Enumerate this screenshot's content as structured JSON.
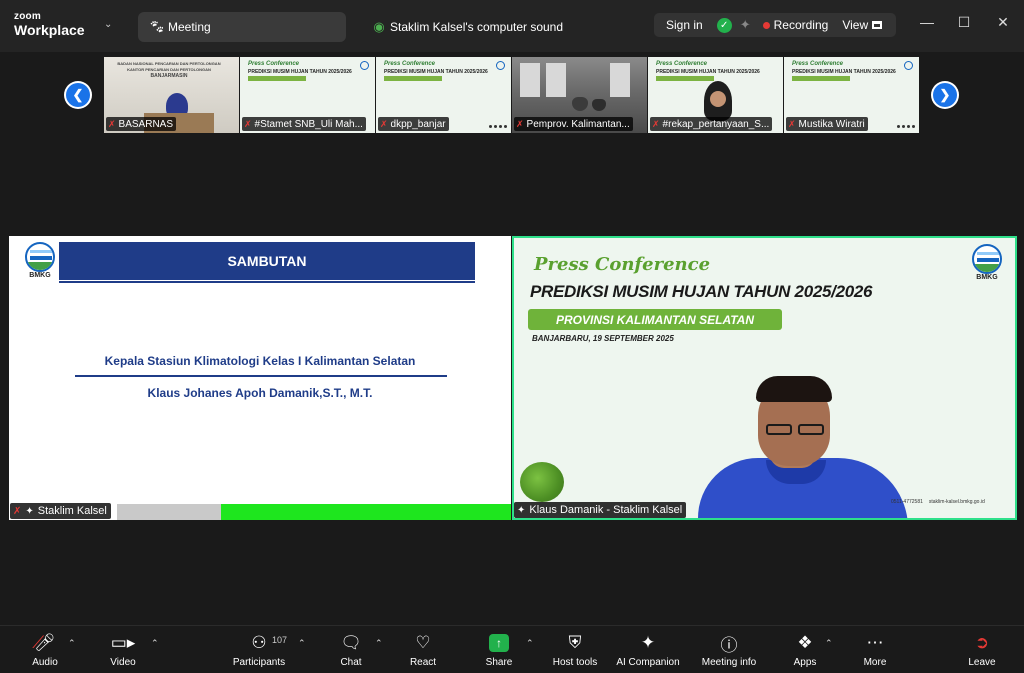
{
  "app": {
    "brand_top": "zoom",
    "brand_bottom": "Workplace"
  },
  "tabs": [
    {
      "label": "Meeting",
      "icon": "paw-icon"
    },
    {
      "label": "Staklim Kalsel's computer sound",
      "icon": "speaker-share-icon"
    }
  ],
  "header": {
    "sign_in": "Sign in",
    "recording": "Recording",
    "view": "View"
  },
  "thumbnails": [
    {
      "name": "BASARNAS",
      "muted": true
    },
    {
      "name": "#Stamet SNB_Uli Mah...",
      "muted": true
    },
    {
      "name": "dkpp_banjar",
      "muted": true
    },
    {
      "name": "Pemprov. Kalimantan...",
      "muted": true
    },
    {
      "name": "#rekap_pertanyaan_S...",
      "muted": true
    },
    {
      "name": "Mustika Wiratri",
      "muted": true
    }
  ],
  "thumb_slide": {
    "title1": "Press Conference",
    "title2": "PREDIKSI MUSIM HUJAN TAHUN 2025/2026"
  },
  "thumb_office": {
    "sign1": "BADAN NASIONAL PENCARIAN DAN PERTOLONGAN",
    "sign2": "KANTOR PENCARIAN DAN PERTOLONGAN",
    "sign3": "BANJARMASIN"
  },
  "left_tile": {
    "logo_text": "BMKG",
    "heading": "SAMBUTAN",
    "line1": "Kepala Stasiun Klimatologi Kelas I Kalimantan Selatan",
    "line2": "Klaus Johanes Apoh Damanik,S.T., M.T.",
    "participant": "Staklim Kalsel"
  },
  "right_tile": {
    "press": "Press Conference",
    "title": "PREDIKSI MUSIM HUJAN TAHUN 2025/2026",
    "province": "PROVINSI KALIMANTAN SELATAN",
    "date": "BANJARBARU, 19 SEPTEMBER 2025",
    "logo_text": "BMKG",
    "phone": "0511-4772581",
    "site": "staklim-kalsel.bmkg.go.id",
    "participant": "Klaus Damanik - Staklim Kalsel"
  },
  "toolbar": {
    "audio": "Audio",
    "video": "Video",
    "participants": "Participants",
    "participants_count": "107",
    "chat": "Chat",
    "react": "React",
    "share": "Share",
    "host_tools": "Host tools",
    "ai_companion": "AI Companion",
    "meeting_info": "Meeting info",
    "apps": "Apps",
    "more": "More",
    "leave": "Leave"
  },
  "colors": {
    "accent": "#1a73e8",
    "share": "#22b14c",
    "active_speaker": "#2ee08a",
    "slide_blue": "#1f3c88",
    "muted": "#e53935"
  }
}
